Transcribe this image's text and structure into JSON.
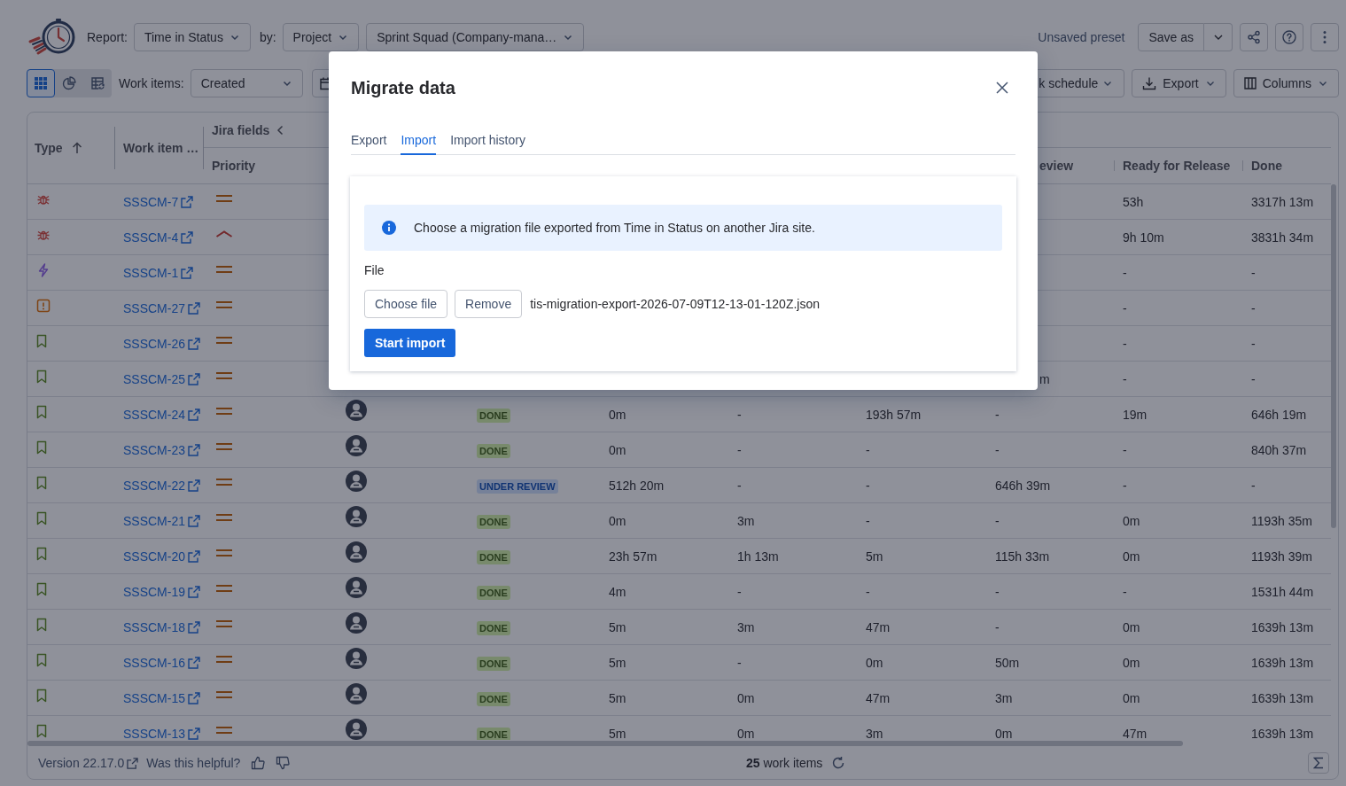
{
  "toolbar": {
    "report_label": "Report:",
    "report": "Time in Status",
    "by_label": "by:",
    "group_by": "Project",
    "project": "Sprint Squad (Company-mana…",
    "preset_status": "Unsaved preset",
    "save_button": "Save as"
  },
  "view_bar": {
    "views": [
      {
        "kind": "grid",
        "selected": true
      },
      {
        "kind": "chart",
        "selected": false
      },
      {
        "kind": "table",
        "selected": false
      }
    ],
    "work_items_label": "Work items:",
    "work_items_filter": "Created",
    "schedule_button": "k schedule",
    "export_button": "Export",
    "columns_button": "Columns"
  },
  "table": {
    "header": {
      "type": "Type",
      "work_item": "Work item …",
      "group": "Jira fields",
      "priority": "Priority",
      "column_9": "eview",
      "ready_for_release": "Ready for Release",
      "done": "Done"
    },
    "rows": [
      {
        "type": {
          "kind": "bug"
        },
        "key": "SSSCM-7",
        "priority": {
          "kind": "medium"
        },
        "ready_for_release": "53h",
        "done": "3317h 13m"
      },
      {
        "type": {
          "kind": "bug"
        },
        "key": "SSSCM-4",
        "priority": {
          "kind": "high"
        },
        "ready_for_release": "9h 10m",
        "done": "3831h 34m"
      },
      {
        "type": {
          "kind": "epic"
        },
        "key": "SSSCM-1",
        "priority": {
          "kind": "medium"
        },
        "ready_for_release": "-",
        "done": "-"
      },
      {
        "type": {
          "kind": "incident"
        },
        "key": "SSSCM-27",
        "priority": {
          "kind": "medium"
        },
        "ready_for_release": "-",
        "done": "-"
      },
      {
        "type": {
          "kind": "story"
        },
        "key": "SSSCM-26",
        "priority": {
          "kind": "medium"
        },
        "ready_for_release": "-",
        "done": "-"
      },
      {
        "type": {
          "kind": "story"
        },
        "key": "SSSCM-25",
        "priority": {
          "kind": "medium"
        },
        "column_9": "m",
        "ready_for_release": "-",
        "done": "-"
      },
      {
        "type": {
          "kind": "story"
        },
        "key": "SSSCM-24",
        "priority": {
          "kind": "medium"
        },
        "avatar": true,
        "status": {
          "label": "DONE",
          "kind": "success"
        },
        "column_6": "0m",
        "column_7": "-",
        "column_8": "193h 57m",
        "column_9": "-",
        "ready_for_release": "19m",
        "done": "646h 19m"
      },
      {
        "type": {
          "kind": "story"
        },
        "key": "SSSCM-23",
        "priority": {
          "kind": "medium"
        },
        "avatar": true,
        "status": {
          "label": "DONE",
          "kind": "success"
        },
        "column_6": "0m",
        "column_7": "-",
        "column_8": "-",
        "column_9": "-",
        "ready_for_release": "-",
        "done": "840h 37m"
      },
      {
        "type": {
          "kind": "story"
        },
        "key": "SSSCM-22",
        "priority": {
          "kind": "medium"
        },
        "avatar": true,
        "status": {
          "label": "UNDER REVIEW",
          "kind": "info"
        },
        "column_6": "512h 20m",
        "column_7": "-",
        "column_8": "-",
        "column_9": "646h 39m",
        "ready_for_release": "-",
        "done": "-"
      },
      {
        "type": {
          "kind": "story"
        },
        "key": "SSSCM-21",
        "priority": {
          "kind": "medium"
        },
        "avatar": true,
        "status": {
          "label": "DONE",
          "kind": "success"
        },
        "column_6": "0m",
        "column_7": "3m",
        "column_8": "-",
        "column_9": "-",
        "ready_for_release": "0m",
        "done": "1193h 35m"
      },
      {
        "type": {
          "kind": "story"
        },
        "key": "SSSCM-20",
        "priority": {
          "kind": "medium"
        },
        "avatar": true,
        "status": {
          "label": "DONE",
          "kind": "success"
        },
        "column_6": "23h 57m",
        "column_7": "1h 13m",
        "column_8": "5m",
        "column_9": "115h 33m",
        "ready_for_release": "0m",
        "done": "1193h 39m"
      },
      {
        "type": {
          "kind": "story"
        },
        "key": "SSSCM-19",
        "priority": {
          "kind": "medium"
        },
        "avatar": true,
        "status": {
          "label": "DONE",
          "kind": "success"
        },
        "column_6": "4m",
        "column_7": "-",
        "column_8": "-",
        "column_9": "-",
        "ready_for_release": "-",
        "done": "1531h 44m"
      },
      {
        "type": {
          "kind": "story"
        },
        "key": "SSSCM-18",
        "priority": {
          "kind": "medium"
        },
        "avatar": true,
        "status": {
          "label": "DONE",
          "kind": "success"
        },
        "column_6": "5m",
        "column_7": "3m",
        "column_8": "47m",
        "column_9": "-",
        "ready_for_release": "0m",
        "done": "1639h 13m"
      },
      {
        "type": {
          "kind": "story"
        },
        "key": "SSSCM-16",
        "priority": {
          "kind": "medium"
        },
        "avatar": true,
        "status": {
          "label": "DONE",
          "kind": "success"
        },
        "column_6": "5m",
        "column_7": "-",
        "column_8": "0m",
        "column_9": "50m",
        "ready_for_release": "0m",
        "done": "1639h 13m"
      },
      {
        "type": {
          "kind": "story"
        },
        "key": "SSSCM-15",
        "priority": {
          "kind": "medium"
        },
        "avatar": true,
        "status": {
          "label": "DONE",
          "kind": "success"
        },
        "column_6": "5m",
        "column_7": "0m",
        "column_8": "47m",
        "column_9": "3m",
        "ready_for_release": "0m",
        "done": "1639h 13m"
      },
      {
        "type": {
          "kind": "story"
        },
        "key": "SSSCM-13",
        "priority": {
          "kind": "medium"
        },
        "avatar": true,
        "status": {
          "label": "DONE",
          "kind": "success"
        },
        "column_6": "5m",
        "column_7": "0m",
        "column_8": "3m",
        "column_9": "0m",
        "ready_for_release": "47m",
        "done": "1639h 13m"
      }
    ]
  },
  "footer": {
    "version": "Version 22.17.0",
    "feedback": "Was this helpful?",
    "count": "**25** work items"
  },
  "modal": {
    "title": "Migrate data",
    "tabs": [
      {
        "label": "Export",
        "selected": false
      },
      {
        "label": "Import",
        "selected": true
      },
      {
        "label": "Import history",
        "selected": false
      }
    ],
    "info": "Choose a migration file exported from Time in Status on another Jira site.",
    "file_label": "File",
    "choose_button": "Choose file",
    "remove_button": "Remove",
    "file_name": "tis-migration-export-2026-07-09T12-13-01-120Z.json",
    "start_button": "Start import"
  }
}
